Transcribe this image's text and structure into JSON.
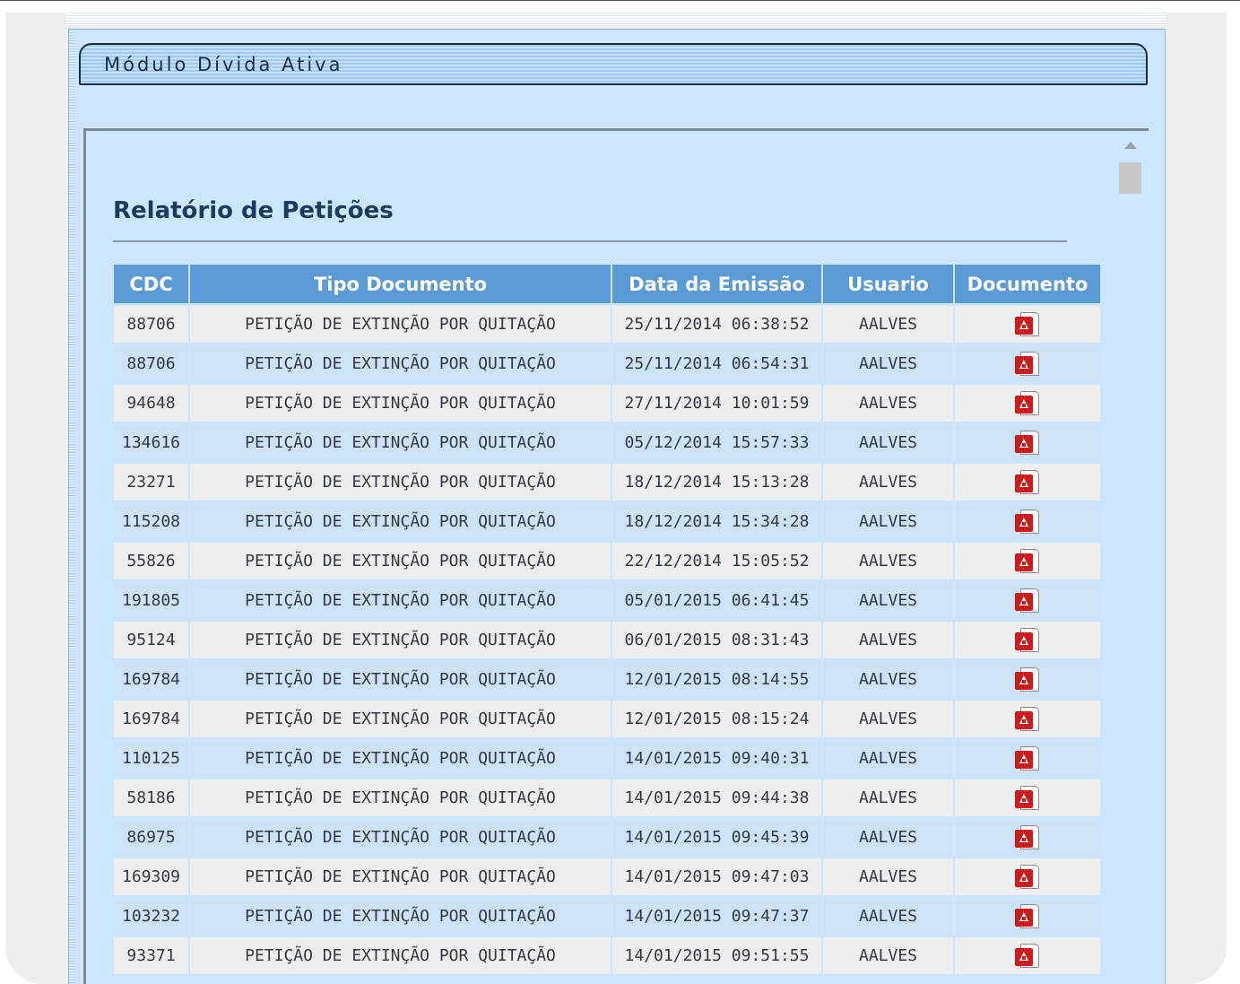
{
  "module": {
    "title": "Módulo Dívida Ativa"
  },
  "report": {
    "title": "Relatório de Petições"
  },
  "table": {
    "headers": [
      "CDC",
      "Tipo Documento",
      "Data da Emissão",
      "Usuario",
      "Documento"
    ],
    "rows": [
      {
        "cdc": "88706",
        "tipo": "PETIÇÃO DE EXTINÇÃO POR QUITAÇÃO",
        "data": "25/11/2014 06:38:52",
        "usuario": "AALVES",
        "documento": "pdf-icon"
      },
      {
        "cdc": "88706",
        "tipo": "PETIÇÃO DE EXTINÇÃO POR QUITAÇÃO",
        "data": "25/11/2014 06:54:31",
        "usuario": "AALVES",
        "documento": "pdf-icon"
      },
      {
        "cdc": "94648",
        "tipo": "PETIÇÃO DE EXTINÇÃO POR QUITAÇÃO",
        "data": "27/11/2014 10:01:59",
        "usuario": "AALVES",
        "documento": "pdf-icon"
      },
      {
        "cdc": "134616",
        "tipo": "PETIÇÃO DE EXTINÇÃO POR QUITAÇÃO",
        "data": "05/12/2014 15:57:33",
        "usuario": "AALVES",
        "documento": "pdf-icon"
      },
      {
        "cdc": "23271",
        "tipo": "PETIÇÃO DE EXTINÇÃO POR QUITAÇÃO",
        "data": "18/12/2014 15:13:28",
        "usuario": "AALVES",
        "documento": "pdf-icon"
      },
      {
        "cdc": "115208",
        "tipo": "PETIÇÃO DE EXTINÇÃO POR QUITAÇÃO",
        "data": "18/12/2014 15:34:28",
        "usuario": "AALVES",
        "documento": "pdf-icon"
      },
      {
        "cdc": "55826",
        "tipo": "PETIÇÃO DE EXTINÇÃO POR QUITAÇÃO",
        "data": "22/12/2014 15:05:52",
        "usuario": "AALVES",
        "documento": "pdf-icon"
      },
      {
        "cdc": "191805",
        "tipo": "PETIÇÃO DE EXTINÇÃO POR QUITAÇÃO",
        "data": "05/01/2015 06:41:45",
        "usuario": "AALVES",
        "documento": "pdf-icon"
      },
      {
        "cdc": "95124",
        "tipo": "PETIÇÃO DE EXTINÇÃO POR QUITAÇÃO",
        "data": "06/01/2015 08:31:43",
        "usuario": "AALVES",
        "documento": "pdf-icon"
      },
      {
        "cdc": "169784",
        "tipo": "PETIÇÃO DE EXTINÇÃO POR QUITAÇÃO",
        "data": "12/01/2015 08:14:55",
        "usuario": "AALVES",
        "documento": "pdf-icon"
      },
      {
        "cdc": "169784",
        "tipo": "PETIÇÃO DE EXTINÇÃO POR QUITAÇÃO",
        "data": "12/01/2015 08:15:24",
        "usuario": "AALVES",
        "documento": "pdf-icon"
      },
      {
        "cdc": "110125",
        "tipo": "PETIÇÃO DE EXTINÇÃO POR QUITAÇÃO",
        "data": "14/01/2015 09:40:31",
        "usuario": "AALVES",
        "documento": "pdf-icon"
      },
      {
        "cdc": "58186",
        "tipo": "PETIÇÃO DE EXTINÇÃO POR QUITAÇÃO",
        "data": "14/01/2015 09:44:38",
        "usuario": "AALVES",
        "documento": "pdf-icon"
      },
      {
        "cdc": "86975",
        "tipo": "PETIÇÃO DE EXTINÇÃO POR QUITAÇÃO",
        "data": "14/01/2015 09:45:39",
        "usuario": "AALVES",
        "documento": "pdf-icon"
      },
      {
        "cdc": "169309",
        "tipo": "PETIÇÃO DE EXTINÇÃO POR QUITAÇÃO",
        "data": "14/01/2015 09:47:03",
        "usuario": "AALVES",
        "documento": "pdf-icon"
      },
      {
        "cdc": "103232",
        "tipo": "PETIÇÃO DE EXTINÇÃO POR QUITAÇÃO",
        "data": "14/01/2015 09:47:37",
        "usuario": "AALVES",
        "documento": "pdf-icon"
      },
      {
        "cdc": "93371",
        "tipo": "PETIÇÃO DE EXTINÇÃO POR QUITAÇÃO",
        "data": "14/01/2015 09:51:55",
        "usuario": "AALVES",
        "documento": "pdf-icon"
      }
    ]
  },
  "colors": {
    "header_bg": "#5b9bd5",
    "row_odd": "#eeeeee",
    "row_even": "#cde2f4",
    "panel_bg": "#cce6ff",
    "pdf_red": "#cc1b1b"
  }
}
